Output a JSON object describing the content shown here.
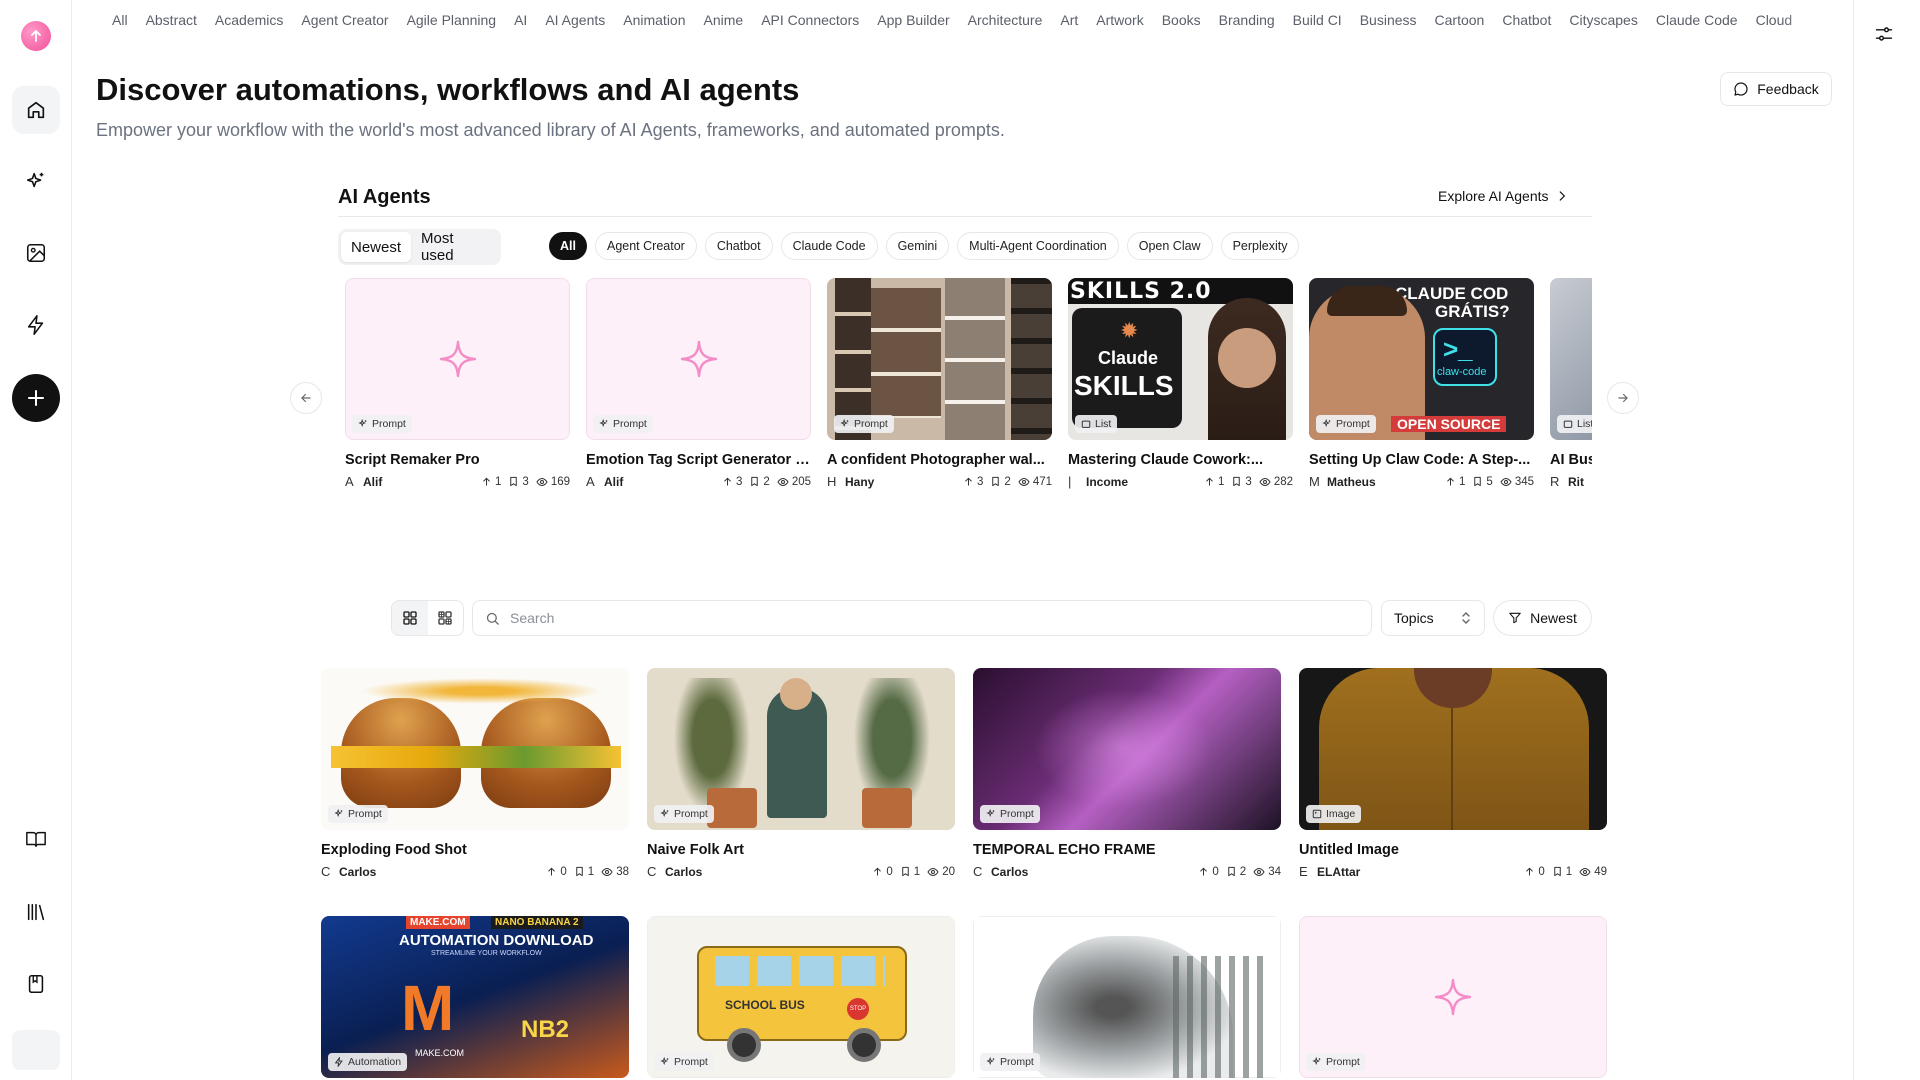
{
  "topnav": [
    "All",
    "Abstract",
    "Academics",
    "Agent Creator",
    "Agile Planning",
    "AI",
    "AI Agents",
    "Animation",
    "Anime",
    "API Connectors",
    "App Builder",
    "Architecture",
    "Art",
    "Artwork",
    "Books",
    "Branding",
    "Build CI",
    "Business",
    "Cartoon",
    "Chatbot",
    "Cityscapes",
    "Claude Code",
    "Cloud"
  ],
  "header": {
    "title": "Discover automations, workflows and AI agents",
    "subtitle": "Empower your workflow with the world's most advanced library of AI Agents, frameworks, and automated prompts.",
    "feedback": "Feedback"
  },
  "agents": {
    "title": "AI Agents",
    "explore": "Explore AI Agents",
    "sort": [
      "Newest",
      "Most used"
    ],
    "chips": [
      "All",
      "Agent Creator",
      "Chatbot",
      "Claude Code",
      "Gemini",
      "Multi-Agent Coordination",
      "Open Claw",
      "Perplexity"
    ],
    "cards": [
      {
        "title": "Script Remaker Pro",
        "initial": "A",
        "author": "Alif",
        "up": "1",
        "saves": "3",
        "views": "169",
        "badge": "Prompt",
        "thumb": "sparkle"
      },
      {
        "title": "Emotion Tag Script Generator f...",
        "initial": "A",
        "author": "Alif",
        "up": "3",
        "saves": "2",
        "views": "205",
        "badge": "Prompt",
        "thumb": "sparkle"
      },
      {
        "title": "A confident Photographer wal...",
        "initial": "H",
        "author": "Hany",
        "up": "3",
        "saves": "2",
        "views": "471",
        "badge": "Prompt",
        "thumb": "photo"
      },
      {
        "title": "Mastering Claude Cowork:...",
        "initial": "|",
        "author": "Income",
        "up": "1",
        "saves": "3",
        "views": "282",
        "badge": "List",
        "thumb": "skills"
      },
      {
        "title": "Setting Up Claw Code: A Step-...",
        "initial": "M",
        "author": "Matheus",
        "up": "1",
        "saves": "5",
        "views": "345",
        "badge": "Prompt",
        "thumb": "claw"
      },
      {
        "title": "AI Bus",
        "initial": "R",
        "author": "Rit",
        "up": "",
        "saves": "",
        "views": "",
        "badge": "List",
        "thumb": "partial"
      }
    ]
  },
  "toolbar": {
    "search_placeholder": "Search",
    "topics": "Topics",
    "newest": "Newest"
  },
  "gallery": [
    {
      "title": "Exploding Food Shot",
      "initial": "C",
      "author": "Carlos",
      "up": "0",
      "saves": "1",
      "views": "38",
      "badge": "Prompt",
      "thumb": "burger"
    },
    {
      "title": "Naive Folk Art",
      "initial": "C",
      "author": "Carlos",
      "up": "0",
      "saves": "1",
      "views": "20",
      "badge": "Prompt",
      "thumb": "folk"
    },
    {
      "title": "TEMPORAL ECHO FRAME",
      "initial": "C",
      "author": "Carlos",
      "up": "0",
      "saves": "2",
      "views": "34",
      "badge": "Prompt",
      "thumb": "echo"
    },
    {
      "title": "Untitled Image",
      "initial": "E",
      "author": "ELAttar",
      "up": "0",
      "saves": "1",
      "views": "49",
      "badge": "Image",
      "thumb": "shirt"
    },
    {
      "title": "",
      "initial": "",
      "author": "",
      "up": "",
      "saves": "",
      "views": "",
      "badge": "Automation",
      "thumb": "automation",
      "thumb_text": [
        "MAKE.COM",
        "NANO BANANA 2",
        "AUTOMATION DOWNLOAD",
        "STREAMLINE YOUR WORKFLOW",
        "NB2",
        "MAKE.COM"
      ]
    },
    {
      "title": "",
      "initial": "",
      "author": "",
      "up": "",
      "saves": "",
      "views": "",
      "badge": "Prompt",
      "thumb": "bus",
      "thumb_text": [
        "SCHOOL BUS",
        "STOP"
      ]
    },
    {
      "title": "",
      "initial": "",
      "author": "",
      "up": "",
      "saves": "",
      "views": "",
      "badge": "Prompt",
      "thumb": "wolf"
    },
    {
      "title": "",
      "initial": "",
      "author": "",
      "up": "",
      "saves": "",
      "views": "",
      "badge": "Prompt",
      "thumb": "sparkle"
    }
  ],
  "thumb_text": {
    "skills": [
      "SKILLS 2.0",
      "Claude",
      "SKILLS"
    ],
    "claw": [
      "CLAUDE COD",
      "GRÁTIS?",
      "claw-code",
      "OPEN SOURCE"
    ]
  },
  "colors": {
    "accent_pink": "#f48cc8",
    "brand": "#f0509a",
    "ink": "#111111"
  }
}
